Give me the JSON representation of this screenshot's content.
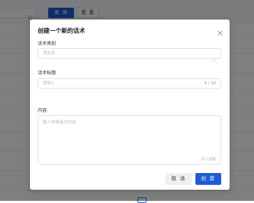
{
  "background": {
    "query_button": "查 询",
    "reset_button": "重 置"
  },
  "dialog": {
    "title": "创建一个新的话术",
    "category": {
      "label": "话术类别",
      "placeholder": "请选择"
    },
    "title_field": {
      "label": "话术标题",
      "placeholder": "请输入",
      "counter": "0 / 50"
    },
    "content_field": {
      "label": "内容",
      "placeholder": "输入快捷语句内容",
      "counter": "0 / 200"
    },
    "cancel_button": "取 消",
    "create_button": "创 建"
  },
  "colors": {
    "primary": "#1f5bd6",
    "overlay": "rgba(0,0,0,0.5)"
  },
  "icons": {
    "search": "search-icon",
    "close": "close-icon",
    "chevron": "chevron-down-icon"
  }
}
